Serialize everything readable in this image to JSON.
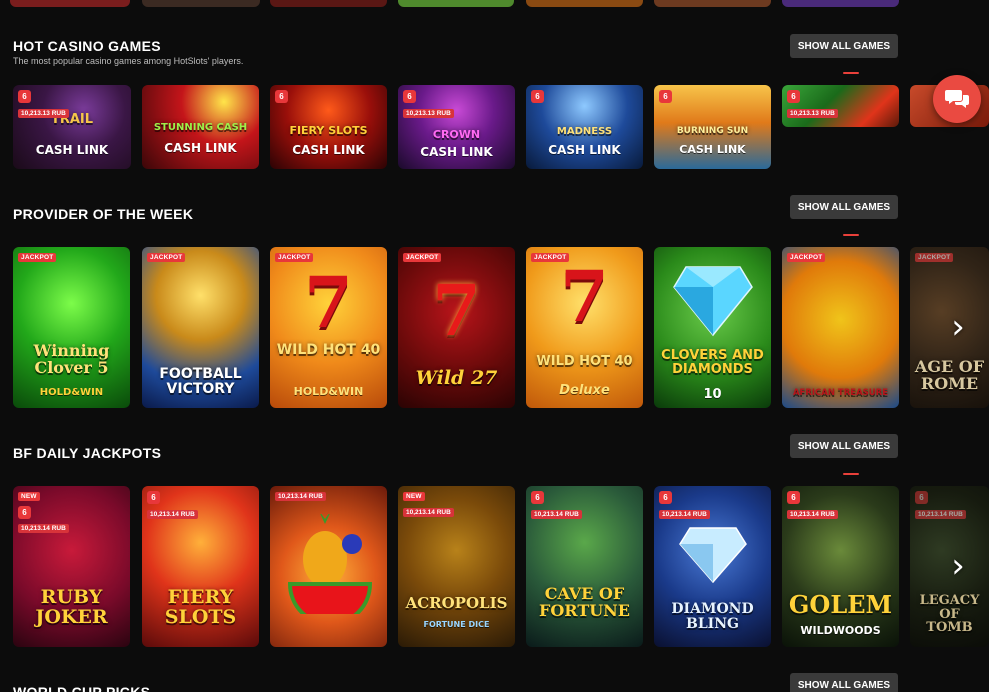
{
  "sections": {
    "hot": {
      "title": "HOT CASINO GAMES",
      "subtitle": "The most popular casino games among HotSlots' players.",
      "show_all": "SHOW ALL GAMES",
      "cards": [
        {
          "amount": "10,213.13 RUB",
          "title": "TRAIL",
          "sub": "CASH LINK"
        },
        {
          "amount": "",
          "title": "STUNNING CASH",
          "sub": "CASH LINK"
        },
        {
          "amount": "",
          "title": "FIERY SLOTS",
          "sub": "CASH LINK"
        },
        {
          "amount": "10,213.13 RUB",
          "title": "CROWN",
          "sub": "CASH LINK"
        },
        {
          "amount": "",
          "title": "MADNESS",
          "sub": "CASH LINK"
        },
        {
          "amount": "",
          "title": "BURNING SUN",
          "sub": "CASH LINK"
        },
        {
          "amount": "10,213.13 RUB",
          "title": "",
          "sub": ""
        }
      ]
    },
    "provider": {
      "title": "PROVIDER OF THE WEEK",
      "show_all": "SHOW ALL GAMES",
      "cards": [
        {
          "badge": "JACKPOT",
          "title": "Winning Clover 5",
          "sub": "HOLD&WIN"
        },
        {
          "badge": "JACKPOT",
          "title": "FOOTBALL VICTORY",
          "sub": ""
        },
        {
          "badge": "JACKPOT",
          "title": "WILD HOT 40",
          "sub": "HOLD&WIN"
        },
        {
          "badge": "JACKPOT",
          "title": "Wild 27",
          "sub": ""
        },
        {
          "badge": "JACKPOT",
          "title": "WILD HOT 40",
          "sub": "Deluxe"
        },
        {
          "badge": "",
          "title": "CLOVERS AND DIAMONDS",
          "sub": "10"
        },
        {
          "badge": "JACKPOT",
          "title": "AFRICAN TREASURE",
          "sub": ""
        },
        {
          "badge": "JACKPOT",
          "title": "AGE OF ROME",
          "sub": ""
        }
      ]
    },
    "bf": {
      "title": "BF DAILY JACKPOTS",
      "show_all": "SHOW ALL GAMES",
      "cards": [
        {
          "badge": "NEW",
          "amount": "10,213.14 RUB",
          "title": "RUBY JOKER",
          "sub": ""
        },
        {
          "badge": "",
          "amount": "10,213.14 RUB",
          "title": "FIERY SLOTS",
          "sub": ""
        },
        {
          "badge": "",
          "amount": "10,213.14 RUB",
          "title": "",
          "sub": ""
        },
        {
          "badge": "NEW",
          "amount": "10,213.14 RUB",
          "title": "ACROPOLIS",
          "sub": "FORTUNE DICE"
        },
        {
          "badge": "",
          "amount": "10,213.14 RUB",
          "title": "CAVE OF FORTUNE",
          "sub": ""
        },
        {
          "badge": "",
          "amount": "10,213.14 RUB",
          "title": "DIAMOND BLING",
          "sub": ""
        },
        {
          "badge": "",
          "amount": "10,213.14 RUB",
          "title": "GOLEM",
          "sub": "WILDWOODS"
        },
        {
          "badge": "",
          "amount": "10,213.14 RUB",
          "title": "LEGACY OF TOMB",
          "sub": ""
        }
      ]
    },
    "world": {
      "title": "WORLD CUP PICKS",
      "show_all": "SHOW ALL GAMES"
    }
  },
  "fire_icon_glyph": "6",
  "arrow_glyph": "›",
  "colors": {
    "accent": "#e8373a",
    "button_bg": "#3a3a3a",
    "chat": "#ea4a41"
  }
}
